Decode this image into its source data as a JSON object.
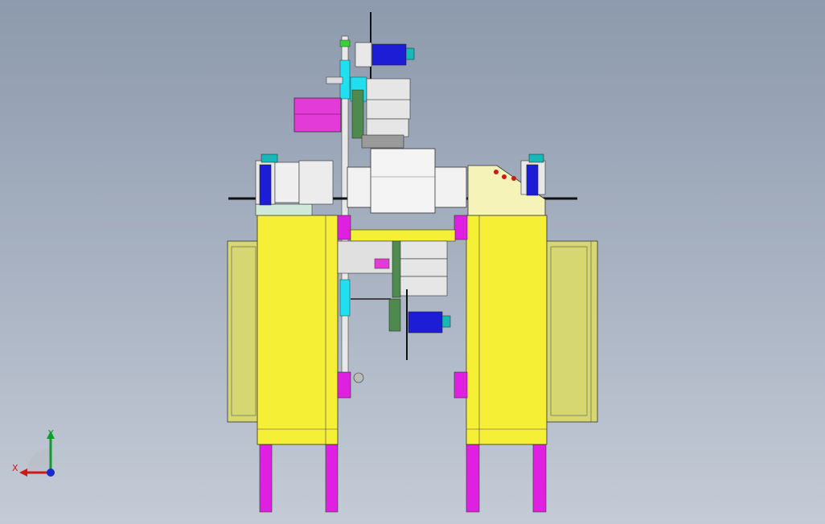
{
  "viewport": {
    "background_top": "#8d9aad",
    "background_bottom": "#c4cbd6"
  },
  "colors": {
    "frame_yellow": "#f5f035",
    "cabinet_olive": "#d6d770",
    "leg_magenta": "#e020e0",
    "motor_blue": "#1d1dd6",
    "motor_cyan": "#18b8b8",
    "accent_cyan": "#20e0f0",
    "gear_green": "#4e8a4e",
    "part_gray": "#dcdcdc",
    "panel_cream": "#f6f3b8",
    "magenta_box": "#e23bd8"
  },
  "triad": {
    "x_label": "X",
    "y_label": "Y",
    "x_color": "#d01818",
    "y_color": "#0a9e2a",
    "z_color": "#1828d0",
    "icon": "coordinate-triad-icon"
  }
}
